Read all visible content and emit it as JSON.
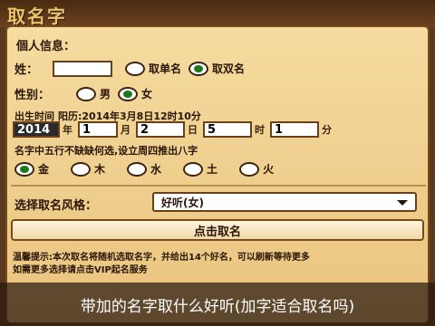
{
  "app": {
    "title": "取名字"
  },
  "form": {
    "personal_info_title": "個人信息：",
    "surname": {
      "label": "姓：",
      "value": ""
    },
    "name_type": {
      "options": [
        "取单名",
        "取双名"
      ],
      "selected": 1
    },
    "gender": {
      "label": "性别：",
      "options": [
        "男",
        "女"
      ],
      "selected": 1
    },
    "birth": {
      "label": "出生时间",
      "hint": "阳历:2014年3月8日12时10分",
      "year": "2014",
      "year_unit": "年",
      "month": "1",
      "month_unit": "月",
      "day": "2",
      "day_unit": "日",
      "hour": "5",
      "hour_unit": "时",
      "minute": "1",
      "minute_unit": "分"
    },
    "five_elements": {
      "prompt": "名字中五行不缺缺何选,设立周四推出八字",
      "options": [
        "金",
        "木",
        "水",
        "土",
        "火"
      ],
      "selected": 0
    },
    "category": {
      "label": "选择取名风格：",
      "value": "好听(女)"
    },
    "submit_label": "点击取名"
  },
  "notes": {
    "line1": "温馨提示:本次取名将随机选取名字，并给出14个好名，可以刷新等待更多",
    "line2": "如需更多选择请点击VIP起名服务"
  },
  "caption": {
    "text": "带加的名字取什么好听(加字适合取名吗)"
  },
  "colors": {
    "panel_bg": "#f6dca0",
    "border": "#7a4a1c",
    "radio_checked": "#1a7a1a",
    "caption_bg": "#28180e"
  }
}
